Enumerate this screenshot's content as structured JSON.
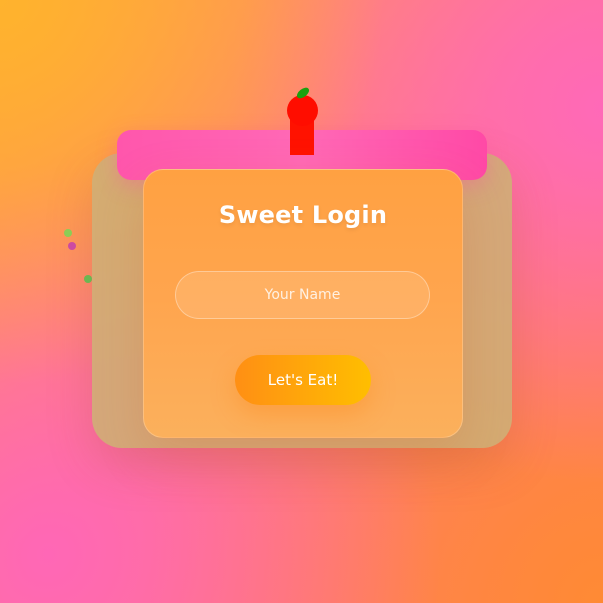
{
  "login": {
    "title": "Sweet Login",
    "name_input": {
      "value": "",
      "placeholder": "Your Name"
    },
    "submit_label": "Let's Eat!"
  },
  "colors": {
    "frosting": "#ff56ac",
    "card": "#ffa142",
    "button_start": "#ff8f14",
    "button_end": "#ffbe00",
    "cherry": "#ff0d00",
    "stem": "#1ba00f"
  }
}
